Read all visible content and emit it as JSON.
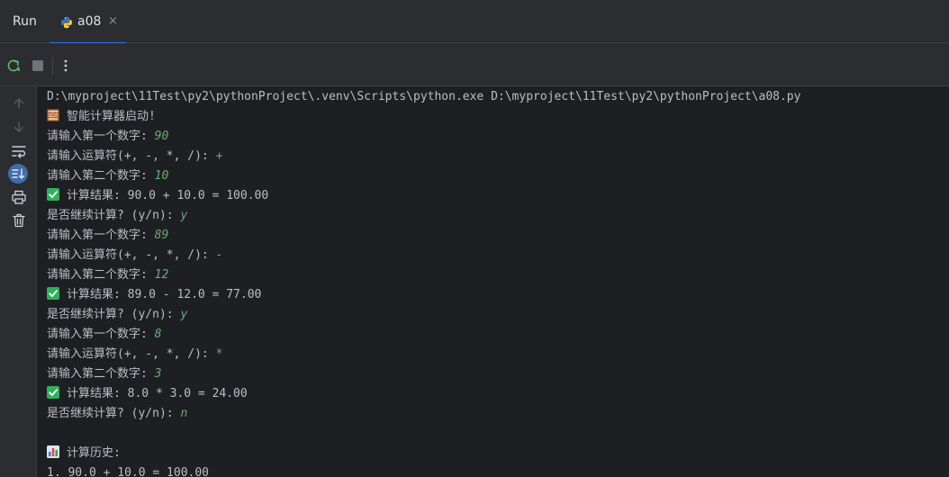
{
  "header": {
    "run_label": "Run",
    "tab": {
      "title": "a08",
      "close": "×",
      "icon": "python-icon"
    }
  },
  "toolbar": {
    "buttons": [
      "rerun-icon",
      "stop-icon",
      "more-icon"
    ]
  },
  "gutter": {
    "buttons": [
      "arrow-up-icon",
      "arrow-down-icon",
      "soft-wrap-icon",
      "scroll-to-end-icon",
      "print-icon",
      "trash-icon"
    ],
    "active": "scroll-to-end-icon"
  },
  "colors": {
    "accent": "#3574f0",
    "input_text": "#6aab73",
    "console_text": "#bcbec4",
    "background": "#1e1f22"
  },
  "console": {
    "command": "D:\\myproject\\11Test\\py2\\pythonProject\\.venv\\Scripts\\python.exe D:\\myproject\\11Test\\py2\\pythonProject\\a08.py",
    "startup": "智能计算器启动!",
    "rounds": [
      {
        "prompt_num1": "请输入第一个数字: ",
        "num1": "90",
        "prompt_op": "请输入运算符(+, -, *, /): ",
        "op": "+",
        "prompt_num2": "请输入第二个数字: ",
        "num2": "10",
        "result": "计算结果: 90.0 + 10.0 = 100.00",
        "prompt_continue": "是否继续计算? (y/n): ",
        "continue": "y"
      },
      {
        "prompt_num1": "请输入第一个数字: ",
        "num1": "89",
        "prompt_op": "请输入运算符(+, -, *, /): ",
        "op": "-",
        "prompt_num2": "请输入第二个数字: ",
        "num2": "12",
        "result": "计算结果: 89.0 - 12.0 = 77.00",
        "prompt_continue": "是否继续计算? (y/n): ",
        "continue": "y"
      },
      {
        "prompt_num1": "请输入第一个数字: ",
        "num1": "8",
        "prompt_op": "请输入运算符(+, -, *, /): ",
        "op": "*",
        "prompt_num2": "请输入第二个数字: ",
        "num2": "3",
        "result": "计算结果: 8.0 * 3.0 = 24.00",
        "prompt_continue": "是否继续计算? (y/n): ",
        "continue": "n"
      }
    ],
    "history_title": "计算历史:",
    "history": [
      "1. 90.0 + 10.0 = 100.00"
    ]
  }
}
